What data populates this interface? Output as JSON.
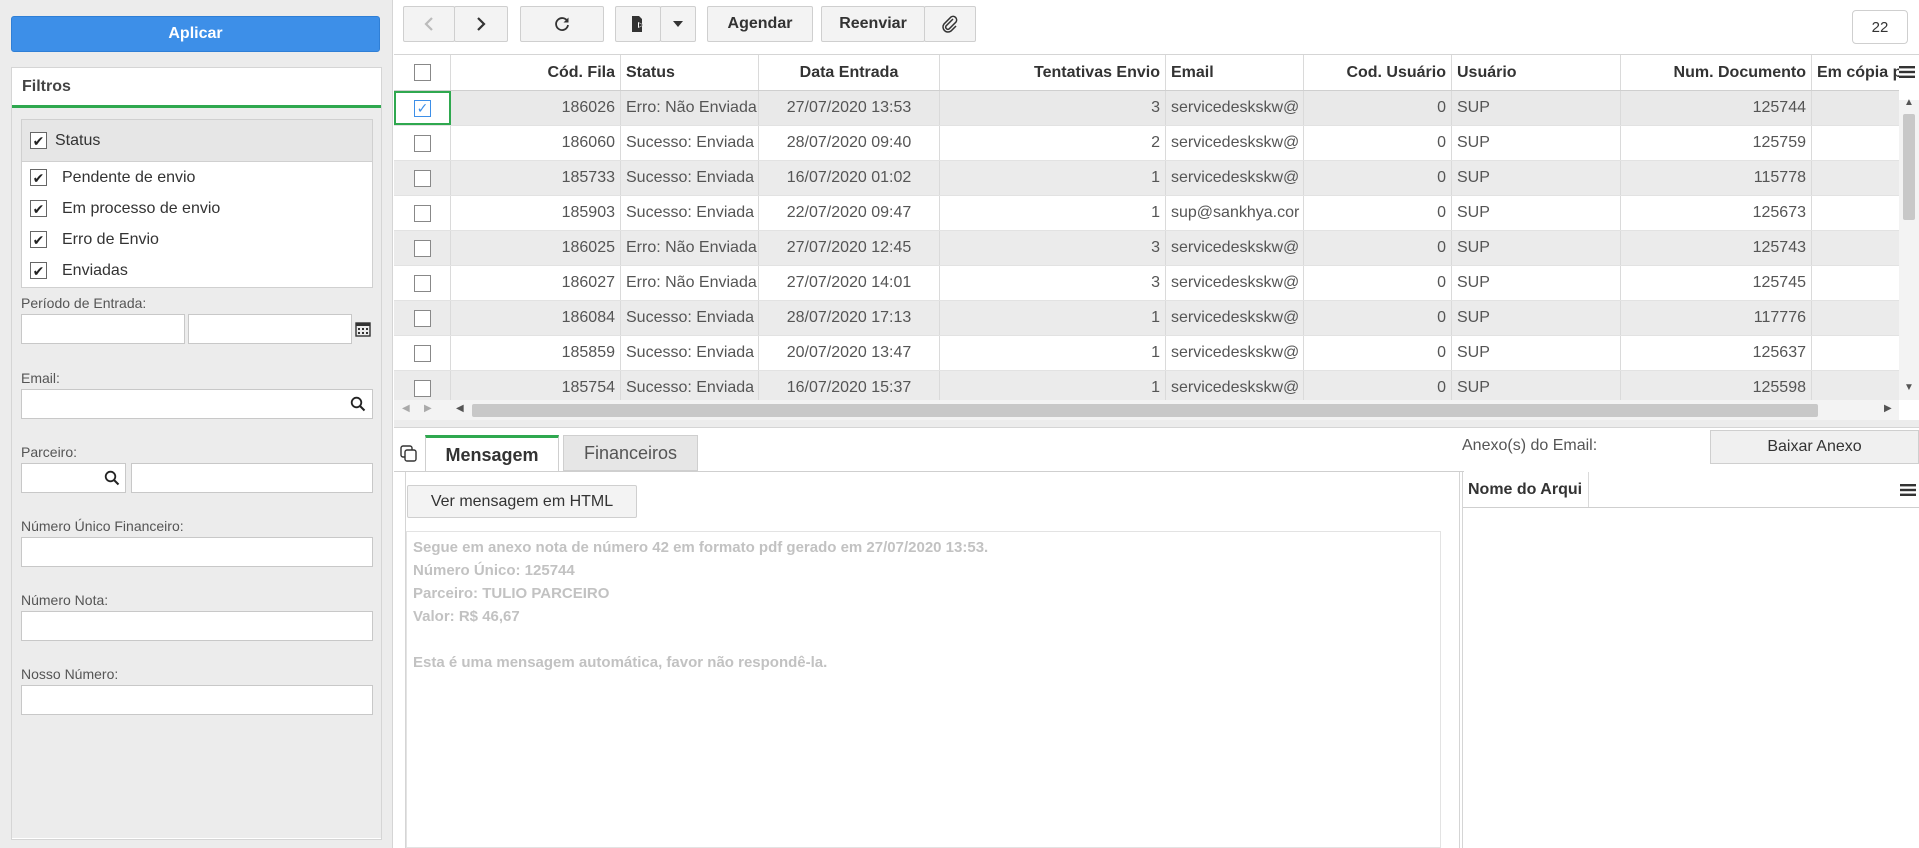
{
  "filters": {
    "apply_label": "Aplicar",
    "title": "Filtros",
    "status_group_label": "Status",
    "status_items": [
      {
        "label": "Pendente de envio",
        "checked": true
      },
      {
        "label": "Em processo de envio",
        "checked": true
      },
      {
        "label": "Erro de Envio",
        "checked": true
      },
      {
        "label": "Enviadas",
        "checked": true
      }
    ],
    "periodo_label": "Período de Entrada:",
    "email_label": "Email:",
    "parceiro_label": "Parceiro:",
    "nufin_label": "Número Único Financeiro:",
    "numnota_label": "Número Nota:",
    "nosso_numero_label": "Nosso Número:"
  },
  "toolbar": {
    "agendar_label": "Agendar",
    "reenviar_label": "Reenviar",
    "counter": "22"
  },
  "grid": {
    "columns": [
      "Cód. Fila",
      "Status",
      "Data Entrada",
      "Tentativas Envio",
      "Email",
      "Cod. Usuário",
      "Usuário",
      "Num. Documento",
      "Em cópia p"
    ],
    "rows": [
      {
        "cod_fila": "186026",
        "status": "Erro: Não Enviada",
        "data": "27/07/2020 13:53",
        "tentativas": "3",
        "email": "servicedeskskw@",
        "cod_usuario": "0",
        "usuario": "SUP",
        "num_doc": "125744",
        "selected": true
      },
      {
        "cod_fila": "186060",
        "status": "Sucesso: Enviada",
        "data": "28/07/2020 09:40",
        "tentativas": "2",
        "email": "servicedeskskw@",
        "cod_usuario": "0",
        "usuario": "SUP",
        "num_doc": "125759",
        "selected": false
      },
      {
        "cod_fila": "185733",
        "status": "Sucesso: Enviada",
        "data": "16/07/2020 01:02",
        "tentativas": "1",
        "email": "servicedeskskw@",
        "cod_usuario": "0",
        "usuario": "SUP",
        "num_doc": "115778",
        "selected": false
      },
      {
        "cod_fila": "185903",
        "status": "Sucesso: Enviada",
        "data": "22/07/2020 09:47",
        "tentativas": "1",
        "email": "sup@sankhya.cor",
        "cod_usuario": "0",
        "usuario": "SUP",
        "num_doc": "125673",
        "selected": false
      },
      {
        "cod_fila": "186025",
        "status": "Erro: Não Enviada",
        "data": "27/07/2020 12:45",
        "tentativas": "3",
        "email": "servicedeskskw@",
        "cod_usuario": "0",
        "usuario": "SUP",
        "num_doc": "125743",
        "selected": false
      },
      {
        "cod_fila": "186027",
        "status": "Erro: Não Enviada",
        "data": "27/07/2020 14:01",
        "tentativas": "3",
        "email": "servicedeskskw@",
        "cod_usuario": "0",
        "usuario": "SUP",
        "num_doc": "125745",
        "selected": false
      },
      {
        "cod_fila": "186084",
        "status": "Sucesso: Enviada",
        "data": "28/07/2020 17:13",
        "tentativas": "1",
        "email": "servicedeskskw@",
        "cod_usuario": "0",
        "usuario": "SUP",
        "num_doc": "117776",
        "selected": false
      },
      {
        "cod_fila": "185859",
        "status": "Sucesso: Enviada",
        "data": "20/07/2020 13:47",
        "tentativas": "1",
        "email": "servicedeskskw@",
        "cod_usuario": "0",
        "usuario": "SUP",
        "num_doc": "125637",
        "selected": false
      },
      {
        "cod_fila": "185754",
        "status": "Sucesso: Enviada",
        "data": "16/07/2020 15:37",
        "tentativas": "1",
        "email": "servicedeskskw@",
        "cod_usuario": "0",
        "usuario": "SUP",
        "num_doc": "125598",
        "selected": false
      }
    ]
  },
  "detail": {
    "tab_mensagem": "Mensagem",
    "tab_financeiros": "Financeiros",
    "html_button_label": "Ver mensagem em HTML",
    "message_lines": [
      "Segue em anexo nota de número 42 em formato pdf gerado em 27/07/2020 13:53.",
      "Número Único: 125744",
      "Parceiro: TULIO PARCEIRO",
      "Valor: R$ 46,67",
      "",
      "Esta é uma mensagem automática, favor não respondê-la."
    ],
    "attachments_label": "Anexo(s) do Email:",
    "download_label": "Baixar Anexo",
    "attachments_column": "Nome do Arqui"
  },
  "colors": {
    "accent_blue": "#3d8fe8",
    "accent_green": "#2fa84f"
  }
}
